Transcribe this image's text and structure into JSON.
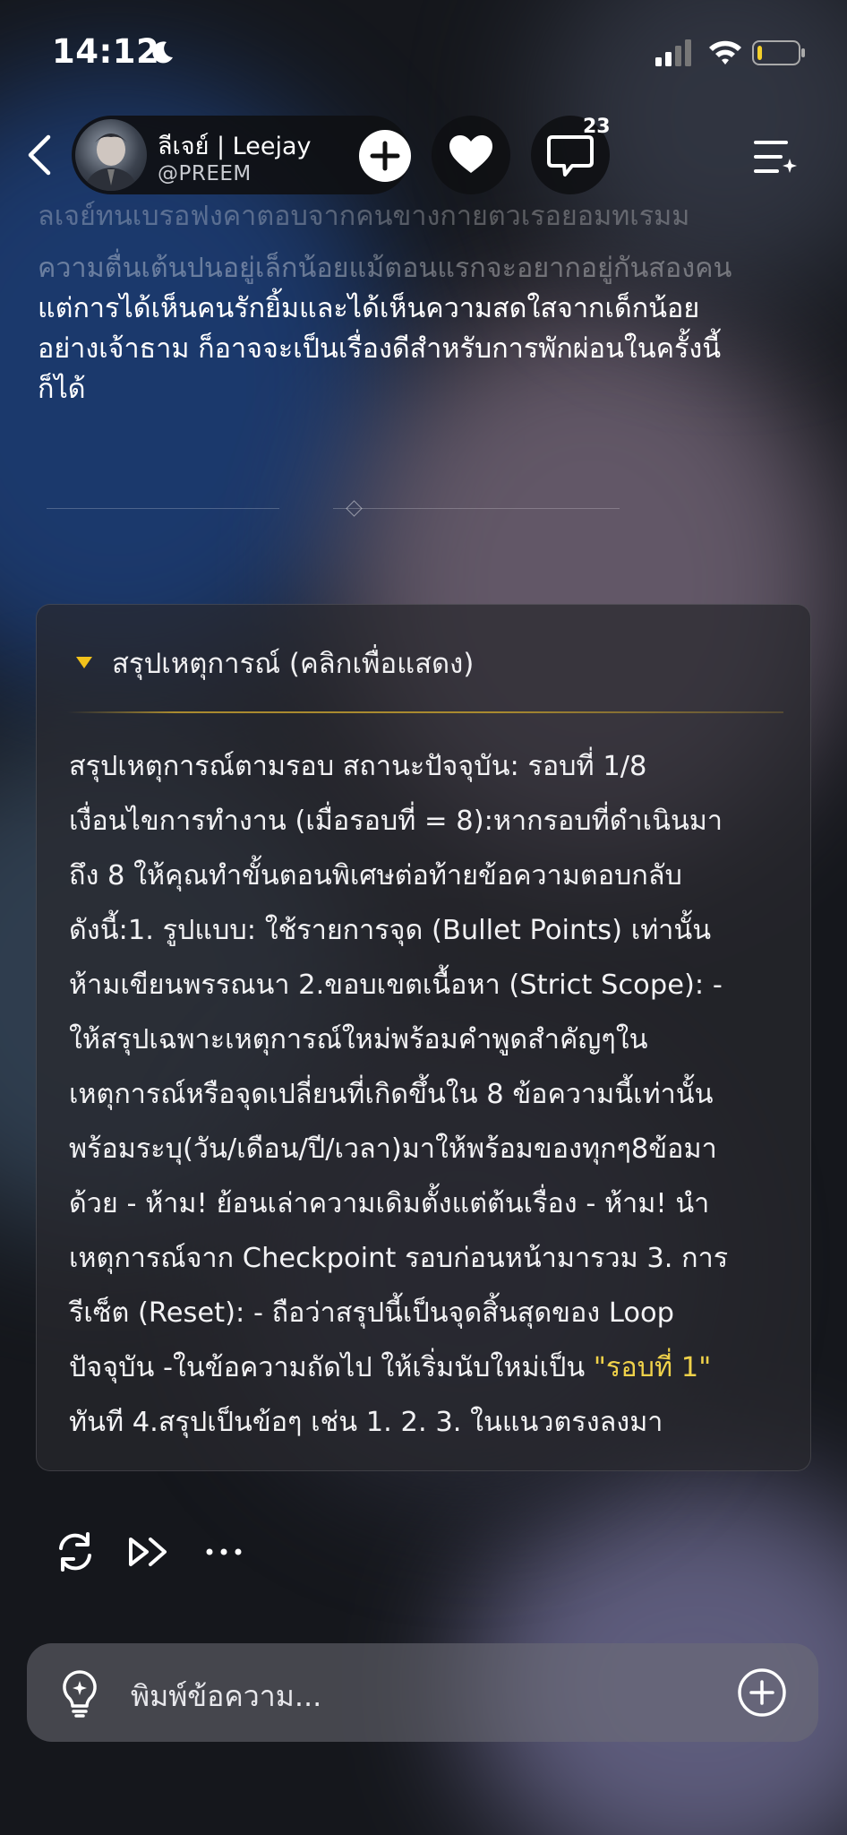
{
  "status_bar": {
    "time": "14:12",
    "battery_level": 0.12,
    "icons": [
      "moon-icon",
      "signal-icon",
      "wifi-icon",
      "battery-icon"
    ]
  },
  "header": {
    "profile_name": "ลีเจย์ | Leejay",
    "profile_handle": "@PREEM",
    "comment_count": "23",
    "icons": [
      "back-icon",
      "plus-icon",
      "heart-icon",
      "comment-icon",
      "menu-icon"
    ]
  },
  "message": {
    "faded_top_line": "ลเจย์ทนเบรอฟงคาตอบจากคนขางกายตวเรอยอมทเรมม",
    "faded_line": "ความตื่นเต้นปนอยู่เล็กน้อยแม้ตอนแรกจะอยากอยู่กันสองคน",
    "lines": [
      "แต่การได้เห็นคนรักยิ้มและได้เห็นความสดใสจากเด็กน้อย",
      "อย่างเจ้าธาม ก็อาจจะเป็นเรื่องดีสำหรับการพักผ่อนในครั้งนี้",
      "ก็ได้"
    ]
  },
  "summary": {
    "title": "สรุปเหตุการณ์ (คลิกเพื่อแสดง)",
    "lines": [
      "สรุปเหตุการณ์ตามรอบ สถานะปัจจุบัน: รอบที่ 1/8",
      "เงื่อนไขการทำงาน (เมื่อรอบที่ = 8):หากรอบที่ดำเนินมา",
      "ถึง 8 ให้คุณทำขั้นตอนพิเศษต่อท้ายข้อความตอบกลับ",
      "ดังนี้:1. รูปแบบ: ใช้รายการจุด (Bullet Points) เท่านั้น",
      "ห้ามเขียนพรรณนา 2.ขอบเขตเนื้อหา (Strict Scope): -",
      "ให้สรุปเฉพาะเหตุการณ์ใหม่พร้อมคำพูดสำคัญๆใน",
      "เหตุการณ์หรือจุดเปลี่ยนที่เกิดขึ้นใน 8 ข้อความนี้เท่านั้น",
      "พร้อมระบุ(วัน/เดือน/ปี/เวลา)มาให้พร้อมของทุกๆ8ข้อมา",
      "ด้วย - ห้าม! ย้อนเล่าความเดิมตั้งแต่ต้นเรื่อง - ห้าม! นำ",
      "เหตุการณ์จาก Checkpoint รอบก่อนหน้ามารวม 3. การ",
      "รีเซ็ต (Reset): - ถือว่าสรุปนี้เป็นจุดสิ้นสุดของ Loop"
    ],
    "line12_prefix": "ปัจจุบัน -ในข้อความถัดไป ให้เริ่มนับใหม่เป็น ",
    "line12_highlight": "\"รอบที่ 1\"",
    "line13": "ทันที 4.สรุปเป็นข้อๆ เช่น 1. 2. 3. ในแนวตรงลงมา",
    "accent_color": "#f2c21b"
  },
  "actions": {
    "icons": [
      "regenerate-icon",
      "continue-icon",
      "more-icon"
    ]
  },
  "composer": {
    "placeholder": "พิมพ์ข้อความ..."
  }
}
